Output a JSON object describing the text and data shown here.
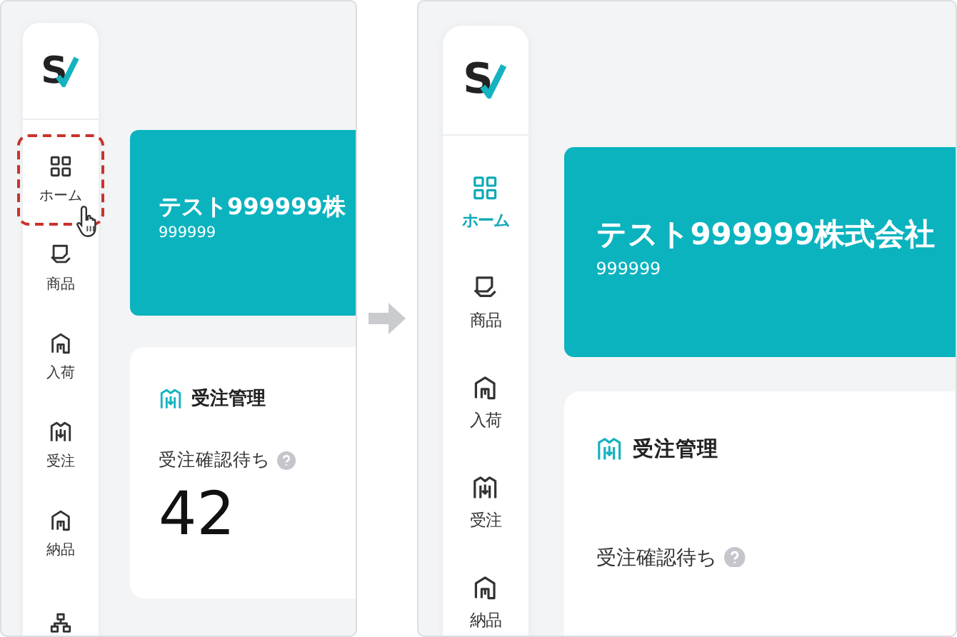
{
  "panels": [
    {
      "logo_text": "S",
      "nav": [
        {
          "label": "ホーム",
          "selected": false,
          "highlighted": true
        },
        {
          "label": "商品",
          "selected": false,
          "highlighted": false
        },
        {
          "label": "入荷",
          "selected": false,
          "highlighted": false
        },
        {
          "label": "受注",
          "selected": false,
          "highlighted": false
        },
        {
          "label": "納品",
          "selected": false,
          "highlighted": false
        },
        {
          "selected": false,
          "highlighted": false
        }
      ],
      "banner": {
        "company": "テスト999999株",
        "code": "999999"
      },
      "card": {
        "title": "受注管理",
        "metric_label": "受注確認待ち",
        "metric_value": "42"
      }
    },
    {
      "logo_text": "S",
      "nav": [
        {
          "label": "ホーム",
          "selected": true,
          "highlighted": false
        },
        {
          "label": "商品",
          "selected": false,
          "highlighted": false
        },
        {
          "label": "入荷",
          "selected": false,
          "highlighted": false
        },
        {
          "label": "受注",
          "selected": false,
          "highlighted": false
        },
        {
          "label": "納品",
          "selected": false,
          "highlighted": false
        }
      ],
      "banner": {
        "company": "テスト999999株式会社",
        "code": "999999"
      },
      "card": {
        "title": "受注管理",
        "metric_label": "受注確認待ち"
      }
    }
  ]
}
